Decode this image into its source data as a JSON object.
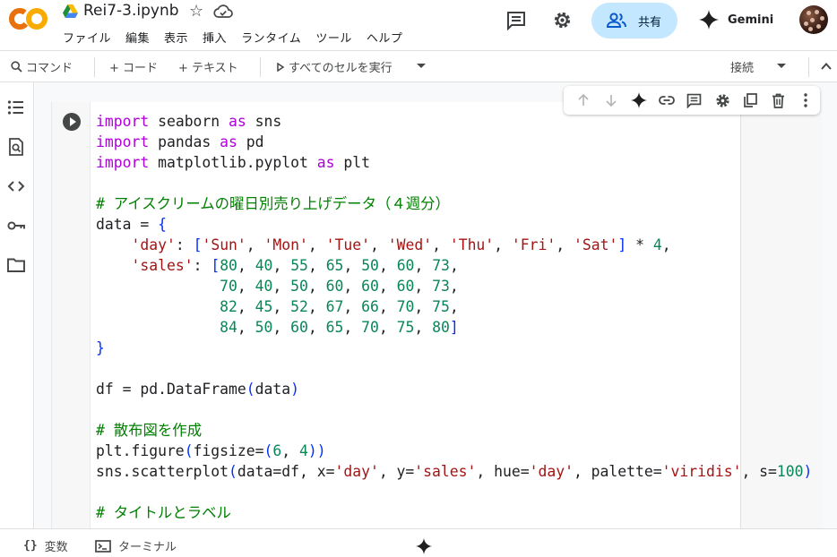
{
  "app": {
    "file_name": "Rei7-3.ipynb",
    "menu": [
      "ファイル",
      "編集",
      "表示",
      "挿入",
      "ランタイム",
      "ツール",
      "ヘルプ"
    ],
    "share_label": "共有",
    "gemini_label": "Gemini"
  },
  "toolbar": {
    "command_label": "コマンド",
    "add_code_label": "+ コード",
    "add_text_label": "+ テキスト",
    "run_all_label": "すべてのセルを実行",
    "connect_label": "接続"
  },
  "statusbar": {
    "variables_label": "変数",
    "terminal_label": "ターミナル"
  },
  "code_cell": {
    "lines": [
      [
        [
          "kw",
          "import"
        ],
        [
          "tx",
          " seaborn "
        ],
        [
          "kw",
          "as"
        ],
        [
          "tx",
          " sns"
        ]
      ],
      [
        [
          "kw",
          "import"
        ],
        [
          "tx",
          " pandas "
        ],
        [
          "kw",
          "as"
        ],
        [
          "tx",
          " pd"
        ]
      ],
      [
        [
          "kw",
          "import"
        ],
        [
          "tx",
          " matplotlib.pyplot "
        ],
        [
          "kw",
          "as"
        ],
        [
          "tx",
          " plt"
        ]
      ],
      [],
      [
        [
          "cm",
          "# アイスクリームの曜日別売り上げデータ（４週分）"
        ]
      ],
      [
        [
          "tx",
          "data = "
        ],
        [
          "br",
          "{"
        ]
      ],
      [
        [
          "tx",
          "    "
        ],
        [
          "st",
          "'day'"
        ],
        [
          "tx",
          ": "
        ],
        [
          "br",
          "["
        ],
        [
          "st",
          "'Sun'"
        ],
        [
          "tx",
          ", "
        ],
        [
          "st",
          "'Mon'"
        ],
        [
          "tx",
          ", "
        ],
        [
          "st",
          "'Tue'"
        ],
        [
          "tx",
          ", "
        ],
        [
          "st",
          "'Wed'"
        ],
        [
          "tx",
          ", "
        ],
        [
          "st",
          "'Thu'"
        ],
        [
          "tx",
          ", "
        ],
        [
          "st",
          "'Fri'"
        ],
        [
          "tx",
          ", "
        ],
        [
          "st",
          "'Sat'"
        ],
        [
          "br",
          "]"
        ],
        [
          "tx",
          " * "
        ],
        [
          "nm",
          "4"
        ],
        [
          "tx",
          ","
        ]
      ],
      [
        [
          "tx",
          "    "
        ],
        [
          "st",
          "'sales'"
        ],
        [
          "tx",
          ": "
        ],
        [
          "br",
          "["
        ],
        [
          "nm",
          "80"
        ],
        [
          "tx",
          ", "
        ],
        [
          "nm",
          "40"
        ],
        [
          "tx",
          ", "
        ],
        [
          "nm",
          "55"
        ],
        [
          "tx",
          ", "
        ],
        [
          "nm",
          "65"
        ],
        [
          "tx",
          ", "
        ],
        [
          "nm",
          "50"
        ],
        [
          "tx",
          ", "
        ],
        [
          "nm",
          "60"
        ],
        [
          "tx",
          ", "
        ],
        [
          "nm",
          "73"
        ],
        [
          "tx",
          ","
        ]
      ],
      [
        [
          "tx",
          "              "
        ],
        [
          "nm",
          "70"
        ],
        [
          "tx",
          ", "
        ],
        [
          "nm",
          "40"
        ],
        [
          "tx",
          ", "
        ],
        [
          "nm",
          "50"
        ],
        [
          "tx",
          ", "
        ],
        [
          "nm",
          "60"
        ],
        [
          "tx",
          ", "
        ],
        [
          "nm",
          "60"
        ],
        [
          "tx",
          ", "
        ],
        [
          "nm",
          "60"
        ],
        [
          "tx",
          ", "
        ],
        [
          "nm",
          "73"
        ],
        [
          "tx",
          ","
        ]
      ],
      [
        [
          "tx",
          "              "
        ],
        [
          "nm",
          "82"
        ],
        [
          "tx",
          ", "
        ],
        [
          "nm",
          "45"
        ],
        [
          "tx",
          ", "
        ],
        [
          "nm",
          "52"
        ],
        [
          "tx",
          ", "
        ],
        [
          "nm",
          "67"
        ],
        [
          "tx",
          ", "
        ],
        [
          "nm",
          "66"
        ],
        [
          "tx",
          ", "
        ],
        [
          "nm",
          "70"
        ],
        [
          "tx",
          ", "
        ],
        [
          "nm",
          "75"
        ],
        [
          "tx",
          ","
        ]
      ],
      [
        [
          "tx",
          "              "
        ],
        [
          "nm",
          "84"
        ],
        [
          "tx",
          ", "
        ],
        [
          "nm",
          "50"
        ],
        [
          "tx",
          ", "
        ],
        [
          "nm",
          "60"
        ],
        [
          "tx",
          ", "
        ],
        [
          "nm",
          "65"
        ],
        [
          "tx",
          ", "
        ],
        [
          "nm",
          "70"
        ],
        [
          "tx",
          ", "
        ],
        [
          "nm",
          "75"
        ],
        [
          "tx",
          ", "
        ],
        [
          "nm",
          "80"
        ],
        [
          "br",
          "]"
        ]
      ],
      [
        [
          "br",
          "}"
        ]
      ],
      [],
      [
        [
          "tx",
          "df = pd.DataFrame"
        ],
        [
          "br",
          "("
        ],
        [
          "tx",
          "data"
        ],
        [
          "br",
          ")"
        ]
      ],
      [],
      [
        [
          "cm",
          "# 散布図を作成"
        ]
      ],
      [
        [
          "tx",
          "plt.figure"
        ],
        [
          "br",
          "("
        ],
        [
          "tx",
          "figsize="
        ],
        [
          "br",
          "("
        ],
        [
          "nm",
          "6"
        ],
        [
          "tx",
          ", "
        ],
        [
          "nm",
          "4"
        ],
        [
          "br",
          "))"
        ]
      ],
      [
        [
          "tx",
          "sns.scatterplot"
        ],
        [
          "br",
          "("
        ],
        [
          "tx",
          "data=df, x="
        ],
        [
          "st",
          "'day'"
        ],
        [
          "tx",
          ", y="
        ],
        [
          "st",
          "'sales'"
        ],
        [
          "tx",
          ", hue="
        ],
        [
          "st",
          "'day'"
        ],
        [
          "tx",
          ", palette="
        ],
        [
          "st",
          "'viridis'"
        ],
        [
          "tx",
          ", s="
        ],
        [
          "nm",
          "100"
        ],
        [
          "br",
          ")"
        ]
      ],
      [],
      [
        [
          "cm",
          "# タイトルとラベル"
        ]
      ]
    ]
  },
  "colors": {
    "keyword": "#af00db",
    "comment": "#008000",
    "string": "#a31515",
    "number": "#098658",
    "bracket": "#0431fa",
    "share_bg": "#c2e7ff",
    "logo_orange": "#f9ab00",
    "logo_dark_orange": "#e8710a"
  },
  "icons": {
    "header": [
      "drive-icon",
      "star-icon",
      "cloud-icon",
      "comment-icon",
      "gear-icon",
      "people-icon",
      "gemini-icon"
    ],
    "sidebar": [
      "toc-icon",
      "search-icon",
      "code-icon",
      "key-icon",
      "folder-icon"
    ],
    "cell_toolbar": [
      "arrow-up-icon",
      "arrow-down-icon",
      "gemini-icon",
      "link-icon",
      "comment-icon",
      "gear-icon",
      "mirror-cell-icon",
      "delete-icon",
      "more-icon"
    ]
  }
}
